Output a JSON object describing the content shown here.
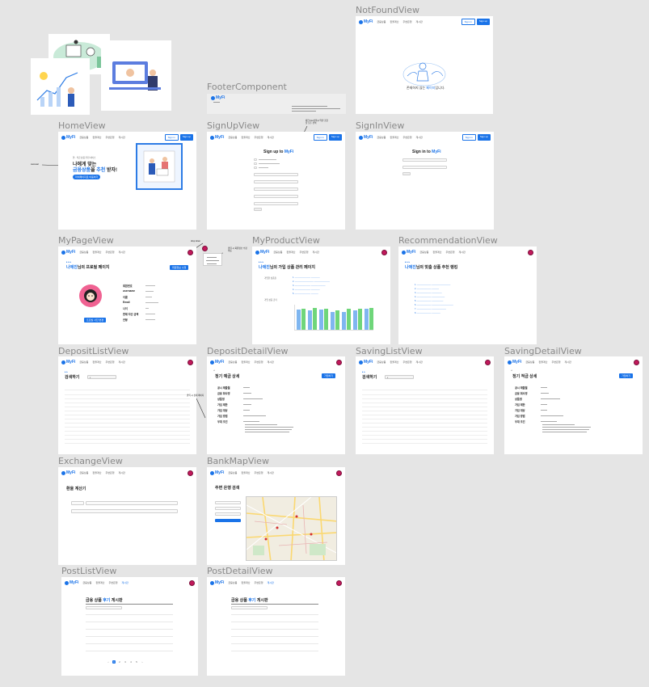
{
  "brand": {
    "name": "MyFi",
    "accent": "#1a73e8",
    "danger": "#c2185b"
  },
  "nav": {
    "items": [
      "금융상품",
      "환율계산",
      "주변은행",
      "게시판"
    ],
    "sign_in": "Sign in",
    "sign_up": "Sign up"
  },
  "frames": {
    "not_found": {
      "label": "NotFoundView",
      "message_pre": "존재하지 않는 ",
      "message_hl": "페이지",
      "message_post": "입니다."
    },
    "footer": {
      "label": "FooterComponent"
    },
    "home": {
      "label": "HomeView",
      "tagline": "연 · 적금 상품 추천 서비스",
      "headline_1": "나에게 맞는",
      "headline_2_pre": "금융상품",
      "headline_2_mid": "을 ",
      "headline_2_hl": "추천",
      "headline_2_post": " 받자!",
      "cta": "마이페이지로 이동하기",
      "annotation": "carousel"
    },
    "sign_up": {
      "label": "SignUpView",
      "title_pre": "Sign up to ",
      "title_brand": "MyFi",
      "annotation": "체크 box선택시 약관 조항들 모두 선택"
    },
    "sign_in": {
      "label": "SignInView",
      "title_pre": "Sign in to ",
      "title_brand": "MyFi"
    },
    "my_page": {
      "label": "MyPageView",
      "title_name": "나애진",
      "title_post": "님의 프로필 페이지",
      "edit_btn": "회원정보 수정",
      "fields": [
        "회원번호",
        "username",
        "이름",
        "Email",
        "나이",
        "현재 자산 금액",
        "연봉"
      ],
      "photo_btn": "프로필 사진 변경",
      "annotation_dropdown": "drop down",
      "annotation_click": "클릭 시 회원정보 수정 이동"
    },
    "my_product": {
      "label": "MyProductView",
      "title_name": "나애진",
      "title_post": "님의 가입 상품 관리 페이지",
      "section_1": "가입한 상품들",
      "section_2": "가입 상품 금리"
    },
    "recommendation": {
      "label": "RecommendationView",
      "title_name": "나애진",
      "title_post": "님의 맞춤 상품 추천 랭킹"
    },
    "deposit_list": {
      "label": "DepositListView",
      "title": "검색하기",
      "annotation": "클릭 시 상세 페이지"
    },
    "deposit_detail": {
      "label": "DepositDetailView",
      "title": "정기 예금 상세",
      "btn": "가입하기",
      "fields": [
        "공시 제출월",
        "금융 회사명",
        "상품명",
        "가입 제한",
        "가입 대상",
        "가입 방법",
        "우대 조건"
      ]
    },
    "saving_list": {
      "label": "SavingListView",
      "title": "검색하기"
    },
    "saving_detail": {
      "label": "SavingDetailView",
      "title": "정기 적금 상세",
      "btn": "가입하기",
      "fields": [
        "공시 제출월",
        "금융 회사명",
        "상품명",
        "가입 제한",
        "가입 대상",
        "가입 방법",
        "우대 조건"
      ]
    },
    "exchange": {
      "label": "ExchangeView",
      "title": "환율 계산기"
    },
    "bank_map": {
      "label": "BankMapView",
      "title": "주변 은행 검색"
    },
    "post_list": {
      "label": "PostListView",
      "title_pre": "금융 상품 ",
      "title_hl": "후기",
      "title_post": " 게시판"
    },
    "post_detail": {
      "label": "PostDetailView",
      "title_pre": "금융 상품 ",
      "title_hl": "후기",
      "title_post": " 게시판"
    }
  },
  "chart_data": {
    "type": "bar",
    "categories": [
      "1",
      "2",
      "3",
      "4",
      "5",
      "6",
      "7"
    ],
    "series": [
      {
        "name": "",
        "values": [
          31,
          30,
          31,
          27,
          28,
          30,
          32
        ]
      },
      {
        "name": "",
        "values": [
          33,
          34,
          33,
          30,
          33,
          33,
          34
        ]
      }
    ],
    "colors": [
      "#7fb6f0",
      "#6fd67a"
    ]
  }
}
